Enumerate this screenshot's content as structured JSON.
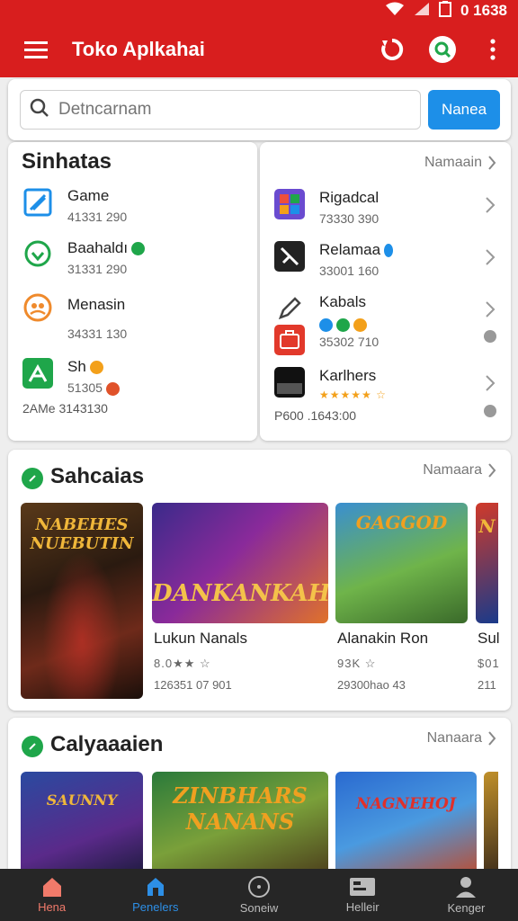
{
  "status": {
    "time": "1638",
    "prefix": "0"
  },
  "appbar": {
    "title": "Toko Aplkahai",
    "icons": [
      "menu-icon",
      "refresh-icon",
      "search-icon",
      "more-vert-icon"
    ]
  },
  "search": {
    "placeholder": "Detncarnam",
    "button": "Nanea"
  },
  "categories": {
    "title": "Sinhatas",
    "see_all": "Namaain",
    "left": [
      {
        "name": "Game",
        "sub": "41331 290"
      },
      {
        "name": "Baahaldı",
        "sub": "31331 290"
      },
      {
        "name": "Menasin",
        "sub": "34331 130"
      },
      {
        "name": "Sh",
        "sub": "51305"
      }
    ],
    "left_footer": "2AMe 3143130",
    "right": [
      {
        "name": "Rigadcal",
        "sub": "73330 390"
      },
      {
        "name": "Relamaa",
        "sub": "33001 160"
      },
      {
        "name": "Kabals",
        "sub": "35302 710"
      },
      {
        "name": "Karlhers",
        "sub": ""
      }
    ],
    "right_footer": "P600 .1643:00"
  },
  "shelf1": {
    "title": "Sahcaias",
    "see_all": "Namaara",
    "tiles": [
      {
        "caption": "NABEHES NUEBUTIN",
        "name": "",
        "meta": ""
      },
      {
        "caption": "DANKANKAH",
        "name": "Lukun Nanals",
        "rating": "8.0★★ ☆",
        "meta": "126351 07 901"
      },
      {
        "caption": "GAGGOD",
        "name": "Alanakin Ron",
        "rating": "93K ☆",
        "meta": "29300hao 43"
      },
      {
        "caption": "N",
        "name": "Sul",
        "rating": "$01",
        "meta": "211"
      }
    ]
  },
  "shelf2": {
    "title": "Calyaaaien",
    "see_all": "Nanaara",
    "tiles": [
      {
        "caption": "SAUNNY"
      },
      {
        "caption": "ZINBHARS NANANS"
      },
      {
        "caption": "NAGNEHOJ"
      }
    ]
  },
  "bottom_nav": [
    {
      "label": "Hena"
    },
    {
      "label": "Penelers"
    },
    {
      "label": "Soneiw"
    },
    {
      "label": "Helleir"
    },
    {
      "label": "Kenger"
    }
  ],
  "colors": {
    "primary": "#d81e1e",
    "accent": "#1d8fe8",
    "green": "#1fa64a"
  }
}
